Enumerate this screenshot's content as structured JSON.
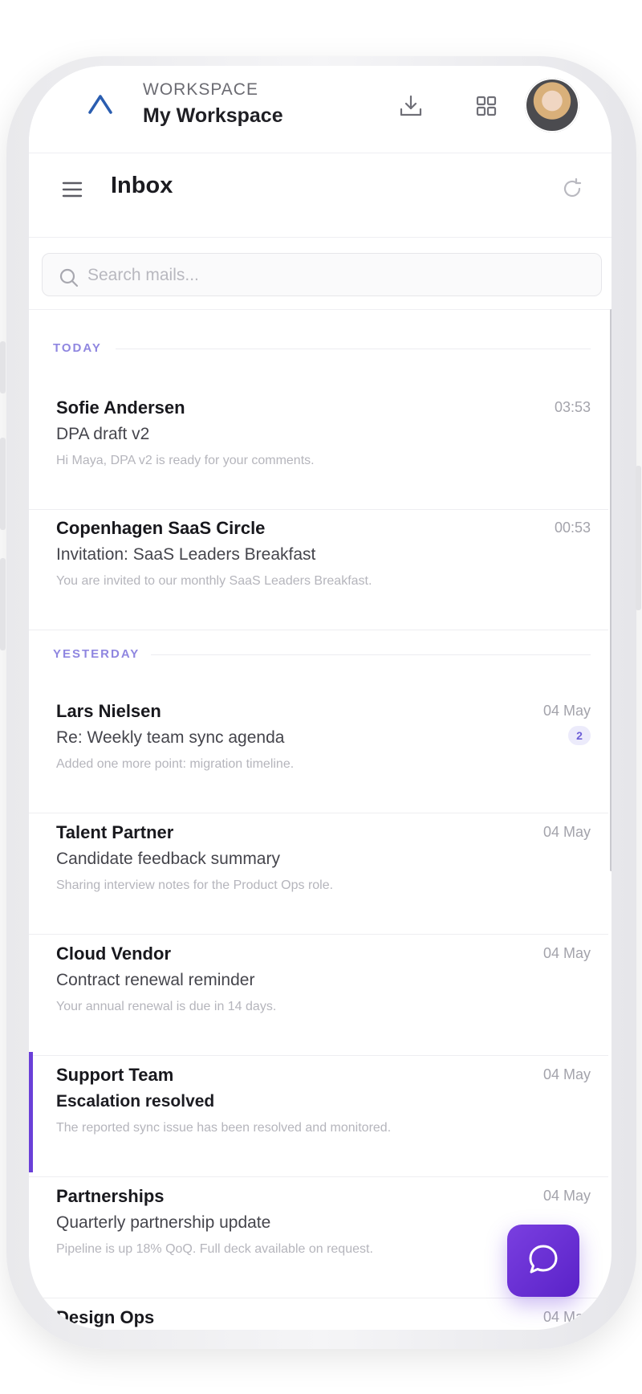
{
  "workspace": {
    "label": "WORKSPACE",
    "name": "My Workspace"
  },
  "inbox": {
    "title": "Inbox"
  },
  "search": {
    "placeholder": "Search mails..."
  },
  "sections": {
    "today": "TODAY",
    "yesterday": "YESTERDAY"
  },
  "mails": [
    {
      "sender": "Sofie Andersen",
      "subject": "DPA draft v2",
      "preview": "Hi Maya, DPA v2 is ready for your comments.",
      "time": "03:53"
    },
    {
      "sender": "Copenhagen SaaS Circle",
      "subject": "Invitation: SaaS Leaders Breakfast",
      "preview": "You are invited to our monthly SaaS Leaders Breakfast.",
      "time": "00:53"
    },
    {
      "sender": "Lars Nielsen",
      "subject": "Re: Weekly team sync agenda",
      "preview": "Added one more point: migration timeline.",
      "time": "04 May",
      "badge": "2"
    },
    {
      "sender": "Talent Partner",
      "subject": "Candidate feedback summary",
      "preview": "Sharing interview notes for the Product Ops role.",
      "time": "04 May"
    },
    {
      "sender": "Cloud Vendor",
      "subject": "Contract renewal reminder",
      "preview": "Your annual renewal is due in 14 days.",
      "time": "04 May"
    },
    {
      "sender": "Support Team",
      "subject": "Escalation resolved",
      "preview": "The reported sync issue has been resolved and monitored.",
      "time": "04 May",
      "unread": true
    },
    {
      "sender": "Partnerships",
      "subject": "Quarterly partnership update",
      "preview": "Pipeline is up 18% QoQ. Full deck available on request.",
      "time": "04 May"
    },
    {
      "sender": "Design Ops",
      "subject": "",
      "preview": "",
      "time": "04 May"
    }
  ],
  "colors": {
    "accent": "#6a3fd8",
    "section": "#8f86e0",
    "logo": "#2a5db0"
  },
  "icons": {
    "logo": "workspace-logo-icon",
    "download": "download-icon",
    "apps": "grid-icon",
    "menu": "hamburger-icon",
    "refresh": "refresh-icon",
    "search": "search-icon",
    "fab": "chat-bubble-icon"
  }
}
